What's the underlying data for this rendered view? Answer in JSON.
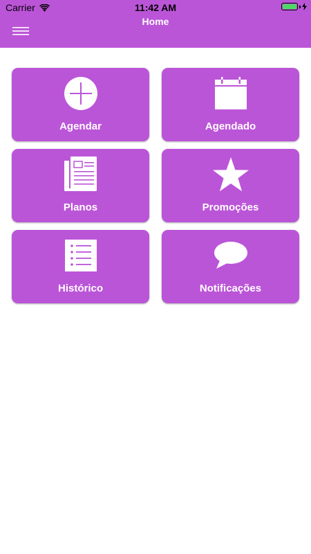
{
  "status_bar": {
    "carrier": "Carrier",
    "time": "11:42 AM",
    "battery_color": "#4cd964"
  },
  "header": {
    "title": "Home",
    "menu_icon": "hamburger-menu-icon",
    "background": "#bb55d8"
  },
  "tiles": [
    {
      "label": "Agendar",
      "icon": "plus-circle-icon"
    },
    {
      "label": "Agendado",
      "icon": "calendar-icon"
    },
    {
      "label": "Planos",
      "icon": "document-icon"
    },
    {
      "label": "Promoções",
      "icon": "star-icon"
    },
    {
      "label": "Histórico",
      "icon": "list-icon"
    },
    {
      "label": "Notificações",
      "icon": "chat-bubble-icon"
    }
  ],
  "colors": {
    "accent": "#bb55d8",
    "tile_text": "#ffffff"
  }
}
